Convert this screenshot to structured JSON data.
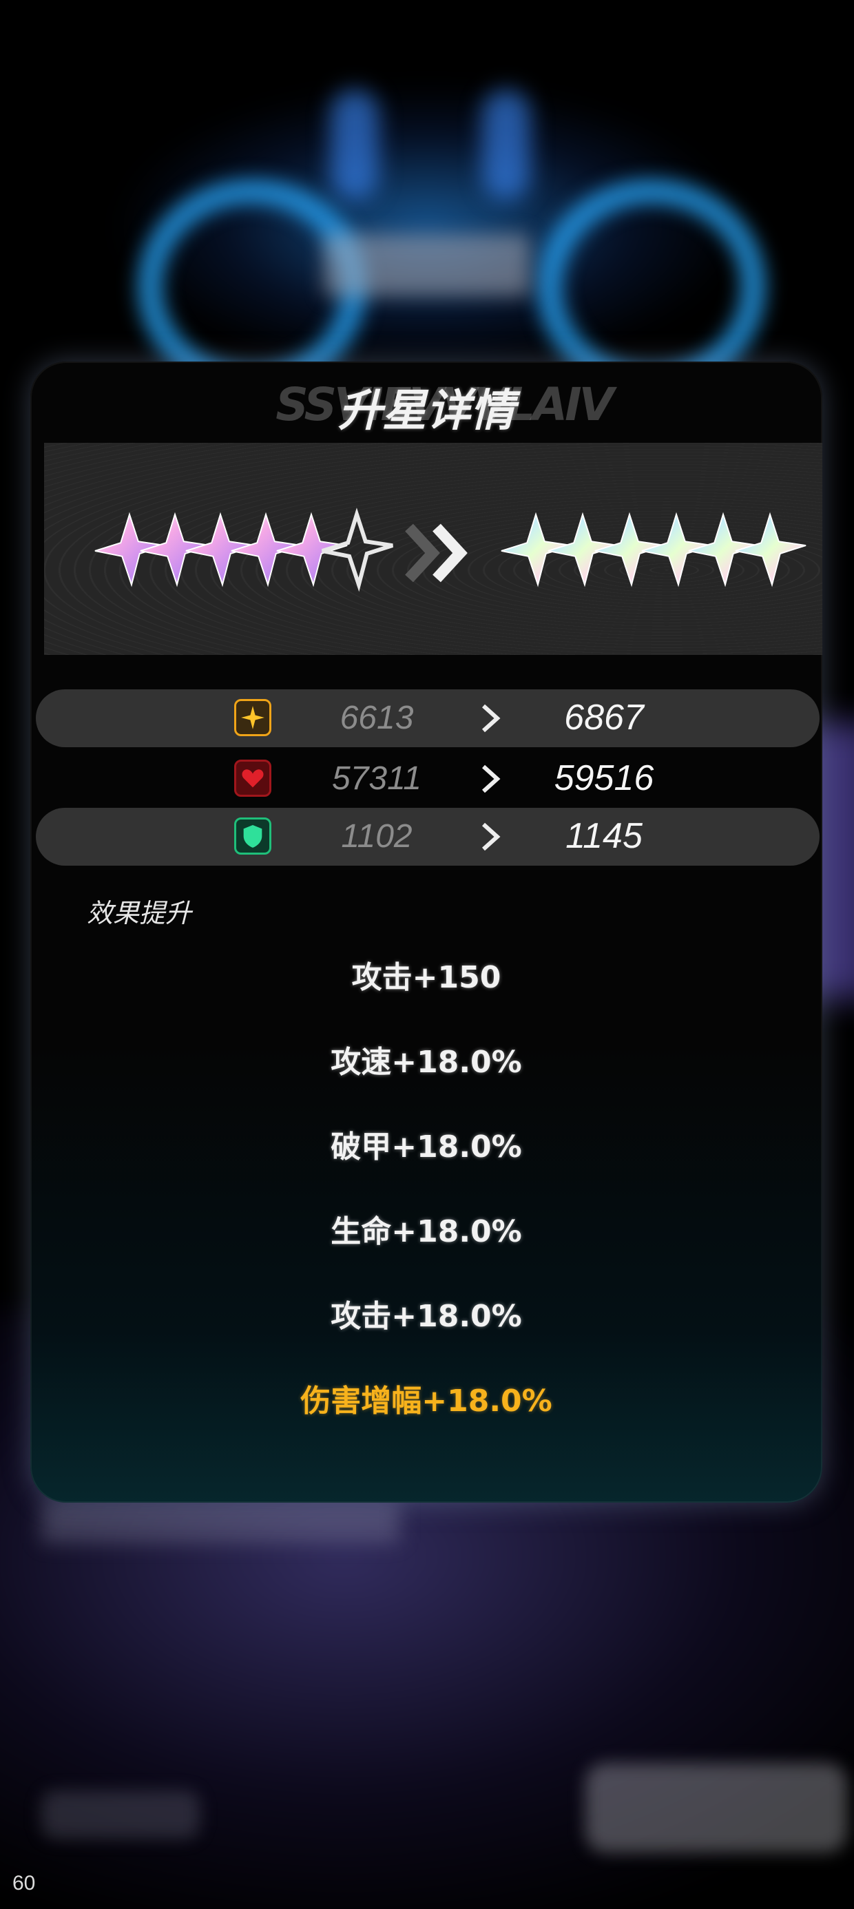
{
  "panel": {
    "title": "升星详情",
    "title_deco": "SSVIEVVVLAIV"
  },
  "stars": {
    "before_filled": 5,
    "before_total": 6,
    "after_filled": 6,
    "after_total": 6
  },
  "stats": [
    {
      "icon": "attack-icon",
      "old": "6613",
      "new": "6867",
      "color": "#f0a418"
    },
    {
      "icon": "health-icon",
      "old": "57311",
      "new": "59516",
      "color": "#e0202a"
    },
    {
      "icon": "defense-icon",
      "old": "1102",
      "new": "1145",
      "color": "#1fbf7a"
    }
  ],
  "effects": {
    "heading": "效果提升",
    "items": [
      {
        "text": "攻击+150",
        "highlight": false
      },
      {
        "text": "攻速+18.0%",
        "highlight": false
      },
      {
        "text": "破甲+18.0%",
        "highlight": false
      },
      {
        "text": "生命+18.0%",
        "highlight": false
      },
      {
        "text": "攻击+18.0%",
        "highlight": false
      },
      {
        "text": "伤害增幅+18.0%",
        "highlight": true
      }
    ]
  },
  "hud": {
    "fps": "60"
  }
}
